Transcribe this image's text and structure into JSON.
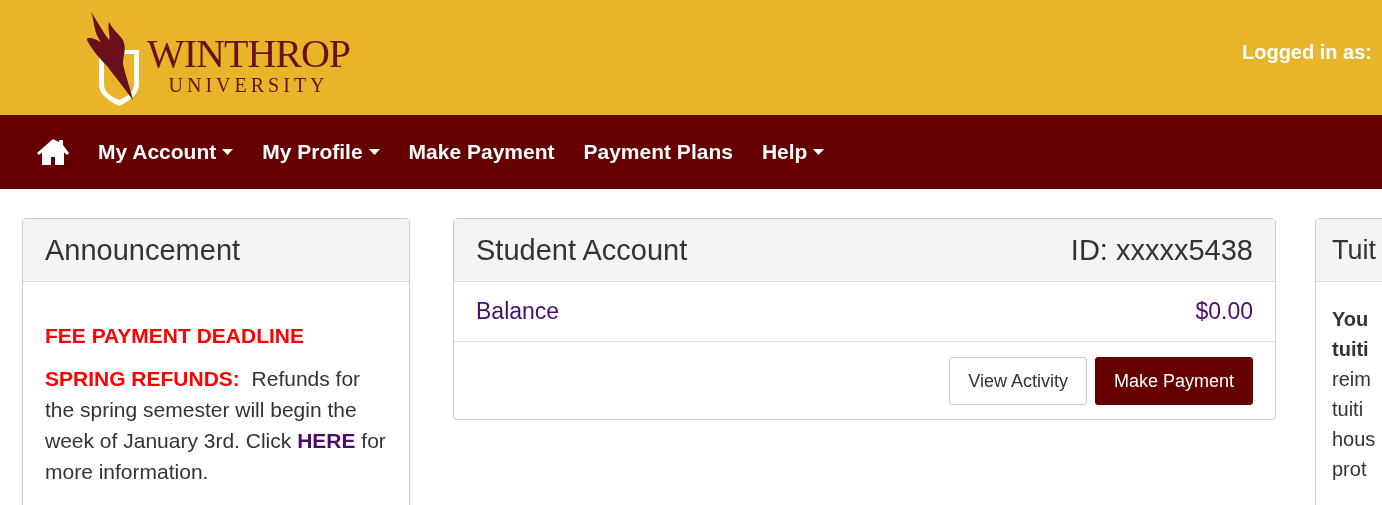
{
  "brand": {
    "name": "WINTHROP",
    "subtitle": "UNIVERSITY"
  },
  "user": {
    "label": "Logged in as:"
  },
  "nav": [
    {
      "label": "My Account",
      "dropdown": true
    },
    {
      "label": "My Profile",
      "dropdown": true
    },
    {
      "label": "Make Payment",
      "dropdown": false
    },
    {
      "label": "Payment Plans",
      "dropdown": false
    },
    {
      "label": "Help",
      "dropdown": true
    }
  ],
  "announcement": {
    "title": "Announcement",
    "headline": "FEE PAYMENT DEADLINE",
    "lead": "SPRING REFUNDS:",
    "text": "Refunds for the spring semester will begin the week of January 3rd. Click",
    "link": "HERE",
    "text_after": "for more information."
  },
  "account": {
    "title": "Student Account",
    "id": "ID: xxxxx5438",
    "balance_label": "Balance",
    "balance": "$0.00",
    "buttons": [
      {
        "label": "View Activity",
        "kind": "default"
      },
      {
        "label": "Make Payment",
        "kind": "primary"
      }
    ]
  },
  "tuition": {
    "title": "Tuit",
    "lines": [
      {
        "text": "You",
        "bold": true
      },
      {
        "text": "tuiti",
        "bold": true
      },
      {
        "text": "reim",
        "bold": false
      },
      {
        "text": "tuiti",
        "bold": false
      },
      {
        "text": "hous",
        "bold": false
      },
      {
        "text": "prot",
        "bold": false
      }
    ]
  }
}
